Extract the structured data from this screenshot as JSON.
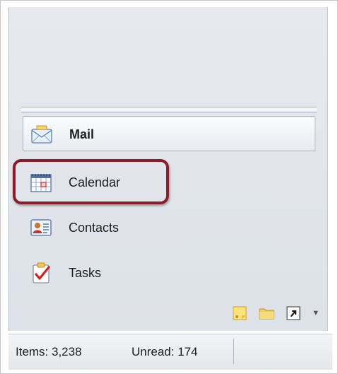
{
  "navigation": {
    "items": [
      {
        "label": "Mail",
        "icon": "mail-envelope-icon",
        "selected": true
      },
      {
        "label": "Calendar",
        "icon": "calendar-icon",
        "selected": false,
        "highlighted": true
      },
      {
        "label": "Contacts",
        "icon": "contacts-card-icon",
        "selected": false
      },
      {
        "label": "Tasks",
        "icon": "tasks-clipboard-icon",
        "selected": false
      }
    ],
    "mini_bar": {
      "icons": [
        "notes-icon",
        "folder-list-icon",
        "shortcuts-icon",
        "configure-buttons-chevron-icon"
      ]
    }
  },
  "status_bar": {
    "items_text": "Items: 3,238",
    "unread_text": "Unread: 174"
  },
  "colors": {
    "highlight_ring": "#8a1c2b",
    "pane_background": "#e1e5ea",
    "selected_item_background": "#f4f6f8"
  }
}
